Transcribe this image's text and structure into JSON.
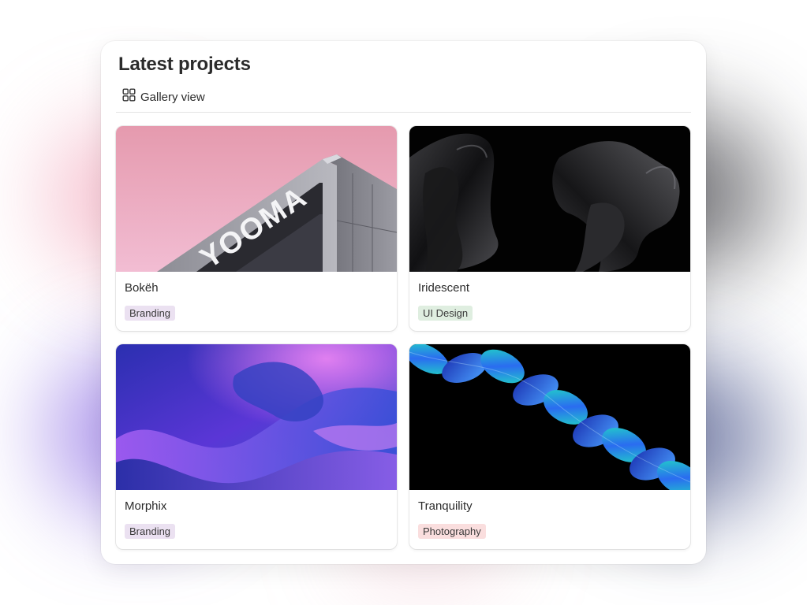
{
  "panel": {
    "title": "Latest projects",
    "view": {
      "label": "Gallery view",
      "icon": "grid-icon"
    }
  },
  "projects": [
    {
      "title": "Bokëh",
      "tag": "Branding",
      "tag_color": "#ebe1f1",
      "cover": "pink-building-image"
    },
    {
      "title": "Iridescent",
      "tag": "UI Design",
      "tag_color": "#dfeee0",
      "cover": "black-abstract-image"
    },
    {
      "title": "Morphix",
      "tag": "Branding",
      "tag_color": "#ebe1f1",
      "cover": "purple-waves-image"
    },
    {
      "title": "Tranquility",
      "tag": "Photography",
      "tag_color": "#fadede",
      "cover": "blue-helix-image"
    }
  ],
  "cover_text": {
    "sign": "YOOMA"
  }
}
